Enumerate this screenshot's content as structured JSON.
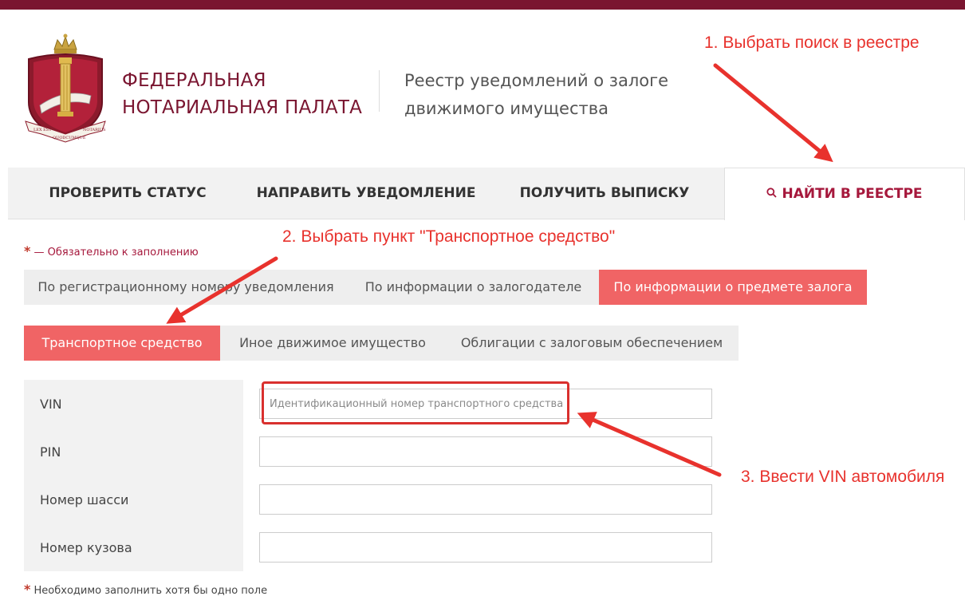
{
  "header": {
    "org_line1": "ФЕДЕРАЛЬНАЯ",
    "org_line2": "НОТАРИАЛЬНАЯ ПАЛАТА",
    "registry_line1": "Реестр уведомлений о залоге",
    "registry_line2": "движимого имущества",
    "logo_motto_left": "LEX EST",
    "logo_motto_right": "NOTARIUS",
    "logo_motto_bottom": "QUODCUMQUE"
  },
  "nav": {
    "items": [
      {
        "label": "ПРОВЕРИТЬ СТАТУС",
        "active": false
      },
      {
        "label": "НАПРАВИТЬ УВЕДОМЛЕНИЕ",
        "active": false
      },
      {
        "label": "ПОЛУЧИТЬ ВЫПИСКУ",
        "active": false
      },
      {
        "label": "НАЙТИ В РЕЕСТРЕ",
        "active": true,
        "icon": "search-icon"
      }
    ]
  },
  "required_note": {
    "star": "*",
    "text": "— Обязательно к заполнению"
  },
  "search_tabs": [
    {
      "label": "По регистрационному номеру уведомления",
      "active": false
    },
    {
      "label": "По информации о залогодателе",
      "active": false
    },
    {
      "label": "По информации о предмете залога",
      "active": true
    }
  ],
  "subject_tabs": [
    {
      "label": "Транспортное средство",
      "active": true
    },
    {
      "label": "Иное движимое имущество",
      "active": false
    },
    {
      "label": "Облигации с залоговым обеспечением",
      "active": false
    }
  ],
  "form": {
    "fields": [
      {
        "label": "VIN",
        "value": "",
        "placeholder": "Идентификационный номер транспортного средства"
      },
      {
        "label": "PIN",
        "value": "",
        "placeholder": ""
      },
      {
        "label": "Номер шасси",
        "value": "",
        "placeholder": ""
      },
      {
        "label": "Номер кузова",
        "value": "",
        "placeholder": ""
      }
    ]
  },
  "bottom_note": {
    "star": "*",
    "text": "Необходимо заполнить хотя бы одно поле"
  },
  "annotations": [
    "1. Выбрать поиск в реестре",
    "2. Выбрать пункт \"Транспортное средство\"",
    "3. Ввести VIN автомобиля"
  ],
  "colors": {
    "brand": "#7a1530",
    "active_tab": "#f06465",
    "annotation": "#e8322d"
  }
}
